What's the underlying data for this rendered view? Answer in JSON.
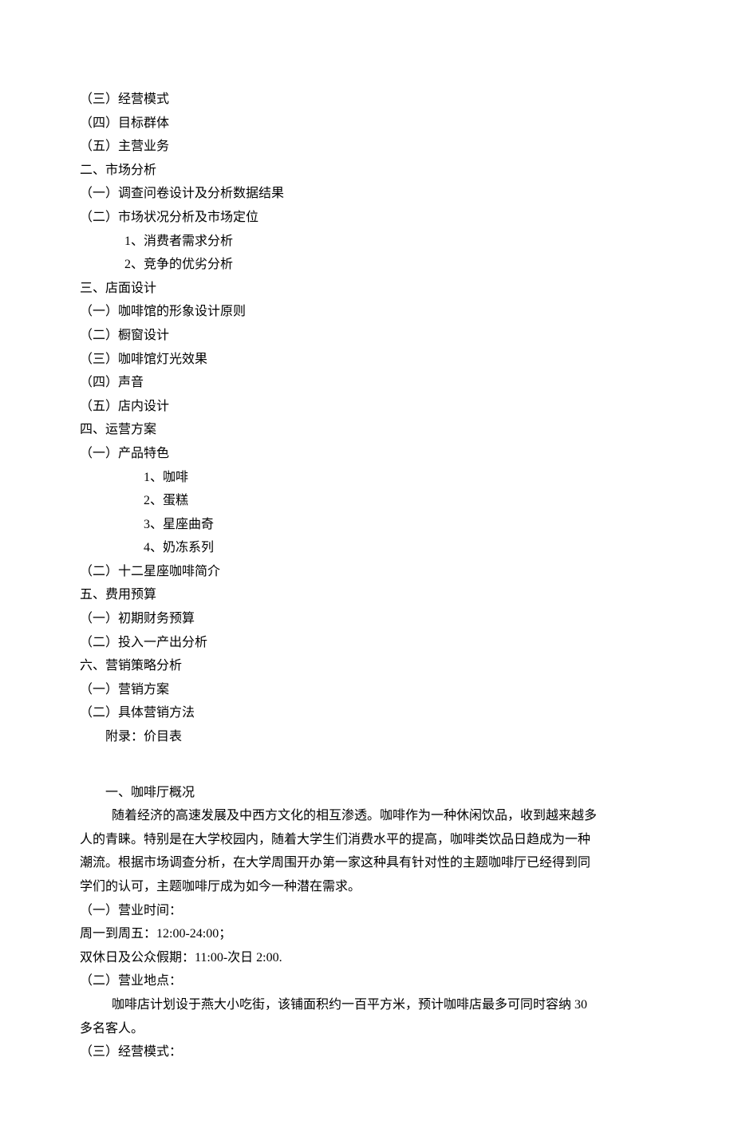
{
  "outline": {
    "l1": "（三）经营模式",
    "l2": "（四）目标群体",
    "l3": "（五）主营业务",
    "l4": "二、市场分析",
    "l5": "（一）调查问卷设计及分析数据结果",
    "l6": "（二）市场状况分析及市场定位",
    "l7": "1、消费者需求分析",
    "l8": "2、竞争的优劣分析",
    "l9": "三、店面设计",
    "l10": "（一）咖啡馆的形象设计原则",
    "l11": "（二）橱窗设计",
    "l12": "（三）咖啡馆灯光效果",
    "l13": "（四）声音",
    "l14": "（五）店内设计",
    "l15": "四、运营方案",
    "l16": "（一）产品特色",
    "l17": "1、咖啡",
    "l18": "2、蛋糕",
    "l19": "3、星座曲奇",
    "l20": "4、奶冻系列",
    "l21": "（二）十二星座咖啡简介",
    "l22": "五、费用预算",
    "l23": "（一）初期财务预算",
    "l24": "（二）投入一产出分析",
    "l25": "六、营销策略分析",
    "l26": "（一）营销方案",
    "l27": "（二）具体营销方法",
    "l28": "附录：价目表"
  },
  "content": {
    "h1": "一、咖啡厅概况",
    "p1a": "随着经济的高速发展及中西方文化的相互渗透。咖啡作为一种休闲饮品，收到越来越多",
    "p1b": "人的青睐。特别是在大学校园内，随着大学生们消费水平的提高，咖啡类饮品日趋成为一种",
    "p1c": "潮流。根据市场调查分析，在大学周围开办第一家这种具有针对性的主题咖啡厅已经得到同",
    "p1d": "学们的认可，主题咖啡厅成为如今一种潜在需求。",
    "s1": "（一）营业时间：",
    "s1a": "周一到周五：12:00-24:00；",
    "s1b": "双休日及公众假期：11:00-次日 2:00.",
    "s2": "（二）营业地点：",
    "s2a": "咖啡店计划设于燕大小吃街，该铺面积约一百平方米，预计咖啡店最多可同时容纳 30",
    "s2b": "多名客人。",
    "s3": "（三）经营模式："
  }
}
